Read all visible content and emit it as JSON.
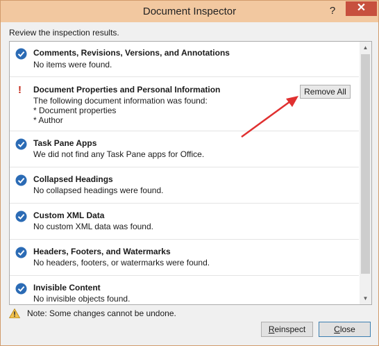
{
  "window": {
    "title": "Document Inspector",
    "help_label": "?",
    "close_glyph": "✕"
  },
  "subtitle": "Review the inspection results.",
  "items": [
    {
      "status": "ok",
      "title": "Comments, Revisions, Versions, and Annotations",
      "lines": [
        "No items were found."
      ]
    },
    {
      "status": "issue",
      "title": "Document Properties and Personal Information",
      "lines": [
        "The following document information was found:",
        "* Document properties",
        "* Author"
      ],
      "action_label": "Remove All"
    },
    {
      "status": "ok",
      "title": "Task Pane Apps",
      "lines": [
        "We did not find any Task Pane apps for Office."
      ]
    },
    {
      "status": "ok",
      "title": "Collapsed Headings",
      "lines": [
        "No collapsed headings were found."
      ]
    },
    {
      "status": "ok",
      "title": "Custom XML Data",
      "lines": [
        "No custom XML data was found."
      ]
    },
    {
      "status": "ok",
      "title": "Headers, Footers, and Watermarks",
      "lines": [
        "No headers, footers, or watermarks were found."
      ]
    },
    {
      "status": "ok",
      "title": "Invisible Content",
      "lines": [
        "No invisible objects found."
      ]
    }
  ],
  "issue_marker": "!",
  "note": "Note: Some changes cannot be undone.",
  "buttons": {
    "reinspect_first": "R",
    "reinspect_rest": "einspect",
    "close_first": "C",
    "close_rest": "lose"
  },
  "colors": {
    "check_blue": "#2b6bb5",
    "issue_red": "#c42b1c",
    "annotation_arrow": "#e03030"
  },
  "icons": {
    "ok": "check-circle-icon",
    "issue": "exclamation-icon",
    "note": "warning-triangle-icon"
  }
}
